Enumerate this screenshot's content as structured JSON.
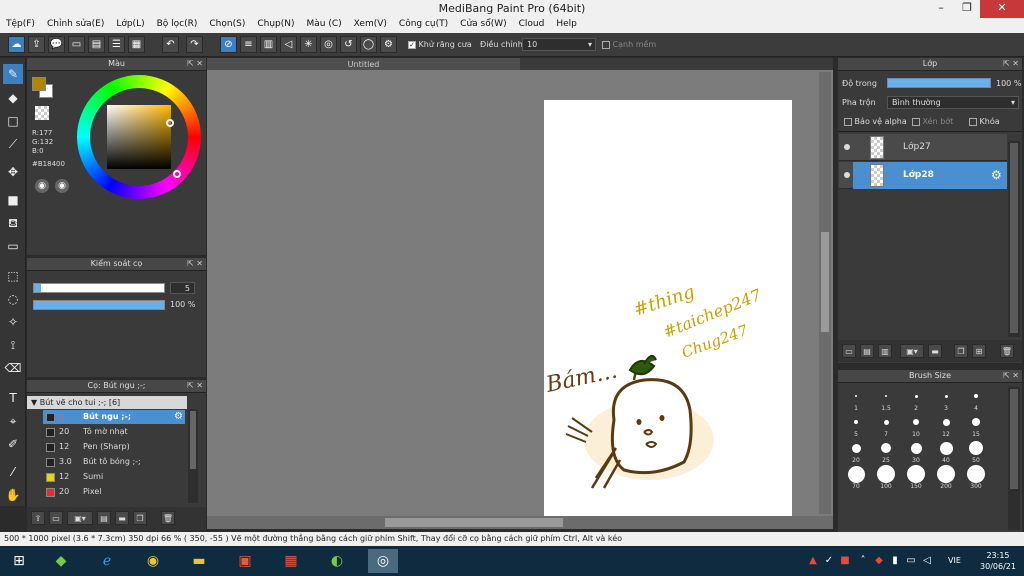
{
  "window": {
    "title": "MediBang Paint Pro (64bit)"
  },
  "menu": [
    "Tệp(F)",
    "Chỉnh sửa(E)",
    "Lớp(L)",
    "Bộ lọc(R)",
    "Chọn(S)",
    "Chụp(N)",
    "Màu (C)",
    "Xem(V)",
    "Công cụ(T)",
    "Cửa sổ(W)",
    "Cloud",
    "Help"
  ],
  "toolbar": {
    "antialias_label": "Khử răng cưa",
    "adjust_label": "Điều chỉnh",
    "adjust_value": "10",
    "edge_label": "Cạnh mềm"
  },
  "color_panel": {
    "title": "Màu",
    "r": "R:177",
    "g": "G:132",
    "b": "B:0",
    "hex": "#B18400",
    "fg_color": "#b18400",
    "bg_color": "#ffffff"
  },
  "brush_control": {
    "title": "Kiểm soát cọ",
    "size_value": "5",
    "size_fraction": 0.05,
    "opacity_value": "100 %",
    "opacity_fraction": 1.0
  },
  "brush_panel": {
    "title": "Cọ: Bút ngu ;-;",
    "group": "Bút vẽ cho tui ;-; [6]",
    "items": [
      {
        "size": "5",
        "name": "Bút ngu ;-;",
        "color": "#222222"
      },
      {
        "size": "20",
        "name": "Tô mờ nhạt",
        "color": "#222222"
      },
      {
        "size": "12",
        "name": "Pen (Sharp)",
        "color": "#222222"
      },
      {
        "size": "3.0",
        "name": "Bút tô bóng ;-;",
        "color": "#222222"
      },
      {
        "size": "12",
        "name": "Sumi",
        "color": "#e8d21a"
      },
      {
        "size": "20",
        "name": "Pixel",
        "color": "#e03030"
      }
    ]
  },
  "canvas": {
    "tab_title": "Untitled"
  },
  "layer_panel": {
    "title": "Lớp",
    "opacity_label": "Độ trong",
    "opacity_value": "100 %",
    "opacity_fraction": 1.0,
    "blend_label": "Pha trộn",
    "blend_value": "Bình thường",
    "protect_alpha": "Bảo vệ alpha",
    "clipping": "Xén bớt",
    "lock": "Khóa",
    "layers": [
      {
        "name": "Lớp27"
      },
      {
        "name": "Lớp28"
      }
    ]
  },
  "brush_size_panel": {
    "title": "Brush Size",
    "sizes": [
      "1",
      "1.5",
      "2",
      "3",
      "4",
      "5",
      "7",
      "10",
      "12",
      "15",
      "20",
      "25",
      "30",
      "40",
      "50",
      "70",
      "100",
      "150",
      "200",
      "300"
    ]
  },
  "status": {
    "text": "500 * 1000 pixel   (3.6 * 7.3cm)   350 dpi   66 %   ( 350, -55 )   Vẽ một đường thẳng bằng cách giữ phím Shift, Thay đổi cỡ cọ bằng cách giữ phím Ctrl, Alt và kéo"
  },
  "taskbar": {
    "lang": "VIE",
    "time": "23:15",
    "date": "30/06/21"
  },
  "drawing": {
    "text1": "Bám…",
    "text2": "#thing",
    "text3": "#taichep247",
    "text4": "Chug247"
  }
}
